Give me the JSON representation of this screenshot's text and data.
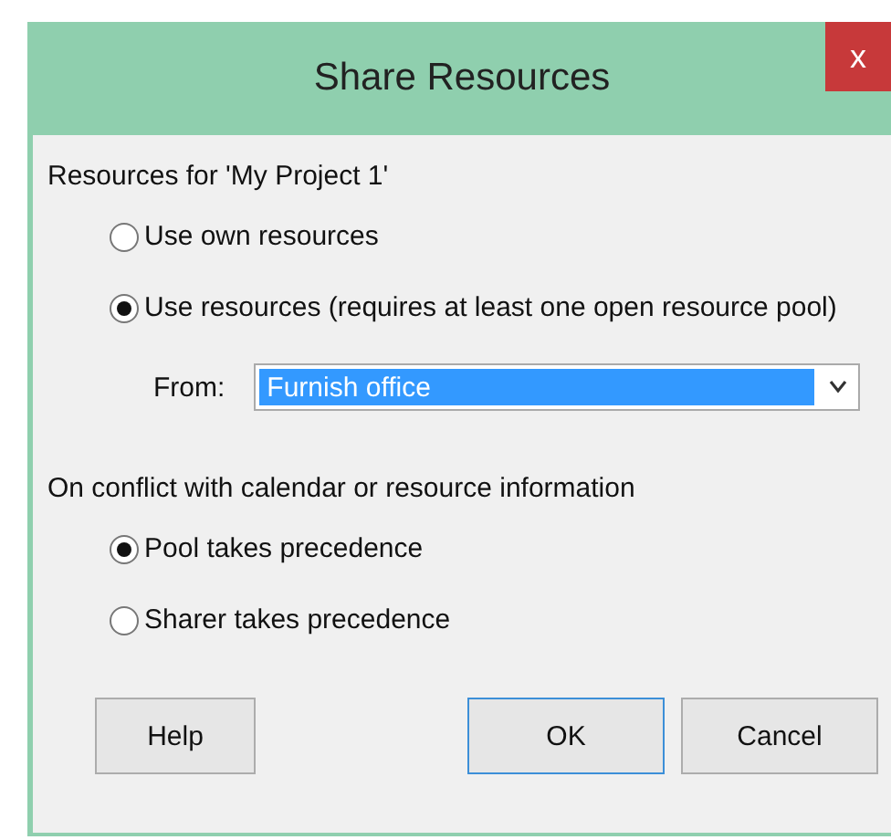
{
  "window": {
    "title": "Share Resources",
    "close": "x"
  },
  "resources_group": {
    "label": "Resources for 'My Project 1'",
    "options": [
      {
        "label": "Use own resources",
        "selected": false
      },
      {
        "label": "Use resources (requires at least one open resource pool)",
        "selected": true
      }
    ]
  },
  "from": {
    "label": "From:",
    "value": "Furnish office",
    "selected": true
  },
  "conflict_group": {
    "label": "On conflict with calendar or resource information",
    "options": [
      {
        "label": "Pool takes precedence",
        "selected": true
      },
      {
        "label": "Sharer takes precedence",
        "selected": false
      }
    ]
  },
  "buttons": [
    {
      "label": "Help",
      "kind": "normal"
    },
    {
      "label": "OK",
      "kind": "default"
    },
    {
      "label": "Cancel",
      "kind": "normal"
    }
  ]
}
